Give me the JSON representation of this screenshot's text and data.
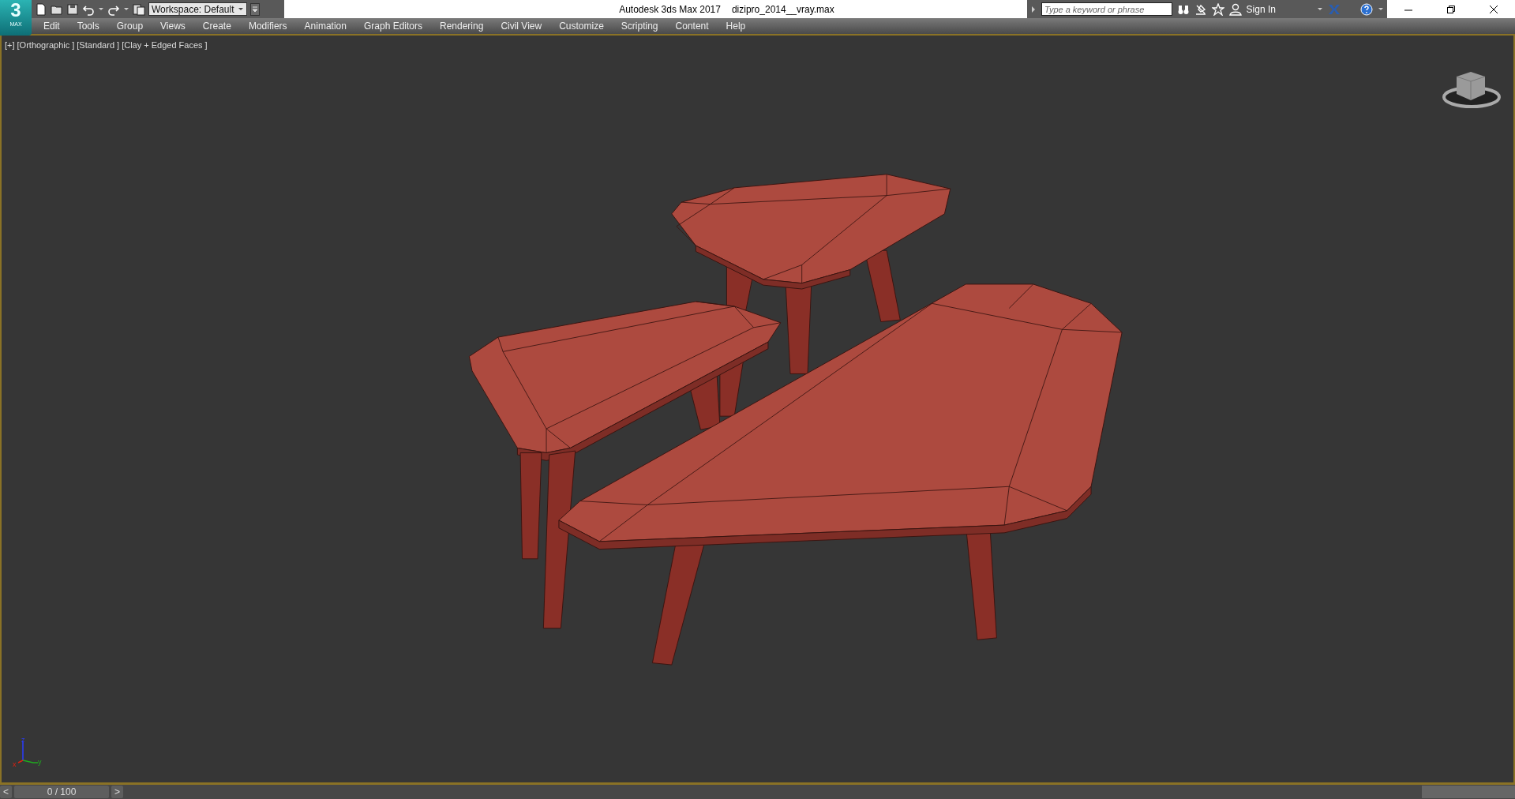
{
  "logo": {
    "digit": "3",
    "sub": "MAX"
  },
  "workspace": {
    "value": "Workspace: Default"
  },
  "window": {
    "title": "Autodesk 3ds Max 2017",
    "file": "dizipro_2014__vray.max"
  },
  "search": {
    "placeholder": "Type a keyword or phrase"
  },
  "account": {
    "sign_in": "Sign In"
  },
  "menu": [
    "Edit",
    "Tools",
    "Group",
    "Views",
    "Create",
    "Modifiers",
    "Animation",
    "Graph Editors",
    "Rendering",
    "Civil View",
    "Customize",
    "Scripting",
    "Content",
    "Help"
  ],
  "viewport": {
    "labels": [
      "[+]",
      "[Orthographic ]",
      "[Standard ]",
      "[Clay + Edged Faces ]"
    ],
    "axes": [
      "z",
      "x",
      "y"
    ]
  },
  "timeline": {
    "prev": "<",
    "frame": "0 / 100",
    "level": 0,
    "next": ">"
  }
}
